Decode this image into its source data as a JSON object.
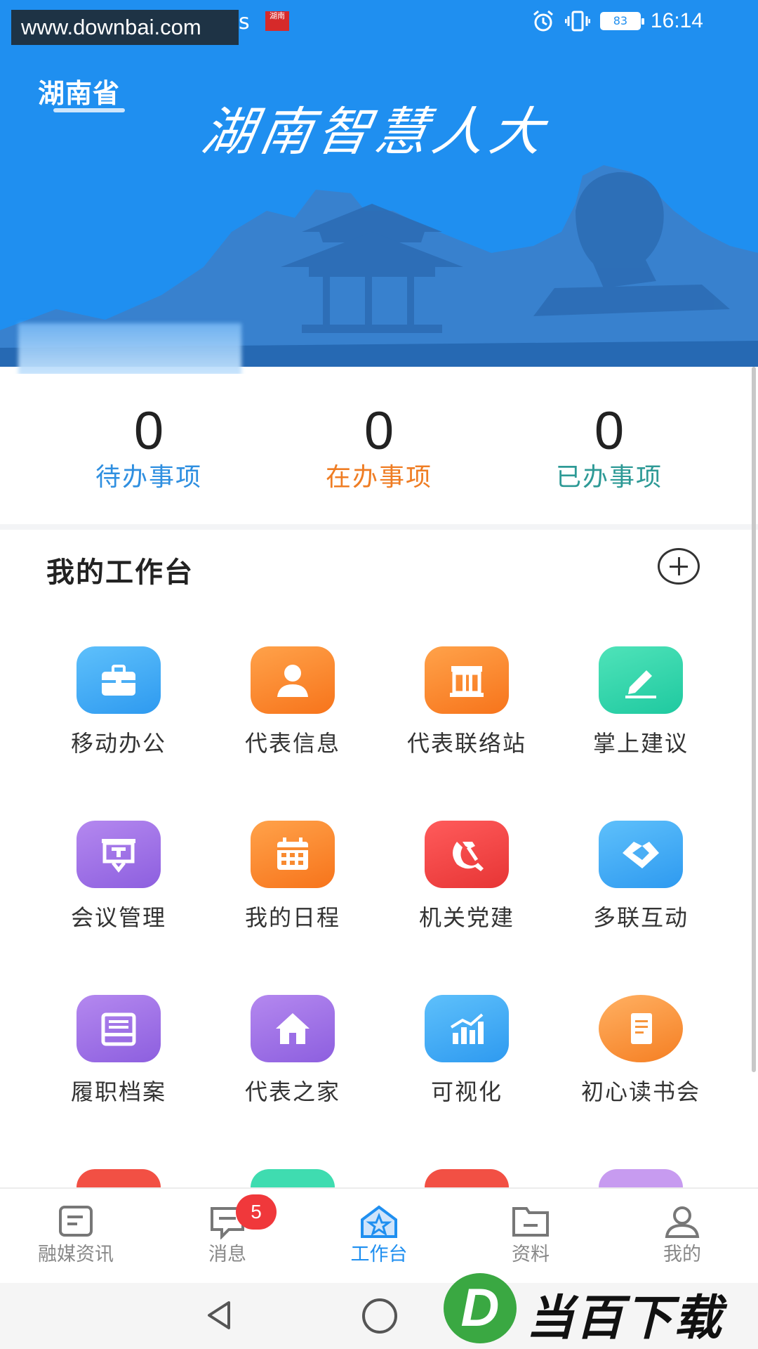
{
  "status_bar": {
    "watermark_url": "www.downbai.com",
    "left_suffix": "s",
    "time": "16:14",
    "battery": "83"
  },
  "header": {
    "region": "湖南省",
    "app_title": "湖南智慧人大"
  },
  "stats": [
    {
      "value": "0",
      "label": "待办事项",
      "color": "#2f8fe0"
    },
    {
      "value": "0",
      "label": "在办事项",
      "color": "#ef7d24"
    },
    {
      "value": "0",
      "label": "已办事项",
      "color": "#2e9a96"
    }
  ],
  "workbench": {
    "title": "我的工作台",
    "tiles": [
      {
        "label": "移动办公",
        "icon": "briefcase-icon"
      },
      {
        "label": "代表信息",
        "icon": "person-icon"
      },
      {
        "label": "代表联络站",
        "icon": "building-icon"
      },
      {
        "label": "掌上建议",
        "icon": "pen-icon"
      },
      {
        "label": "会议管理",
        "icon": "presentation-icon"
      },
      {
        "label": "我的日程",
        "icon": "calendar-icon"
      },
      {
        "label": "机关党建",
        "icon": "party-emblem-icon"
      },
      {
        "label": "多联互动",
        "icon": "handshake-icon"
      },
      {
        "label": "履职档案",
        "icon": "archive-icon"
      },
      {
        "label": "代表之家",
        "icon": "house-icon"
      },
      {
        "label": "可视化",
        "icon": "bar-chart-icon"
      },
      {
        "label": "初心读书会",
        "icon": "book-icon"
      }
    ]
  },
  "bottom_nav": {
    "items": [
      {
        "label": "融媒资讯",
        "icon": "news-icon"
      },
      {
        "label": "消息",
        "icon": "message-icon",
        "badge": "5"
      },
      {
        "label": "工作台",
        "icon": "workbench-icon",
        "active": true
      },
      {
        "label": "资料",
        "icon": "folder-icon"
      },
      {
        "label": "我的",
        "icon": "profile-icon"
      }
    ]
  },
  "watermark": {
    "brand": "当百下载",
    "logo_letter": "D"
  },
  "colors": {
    "banner_blue": "#1f8ff0",
    "active_nav": "#1f8ff0",
    "badge_red": "#f0383b"
  }
}
